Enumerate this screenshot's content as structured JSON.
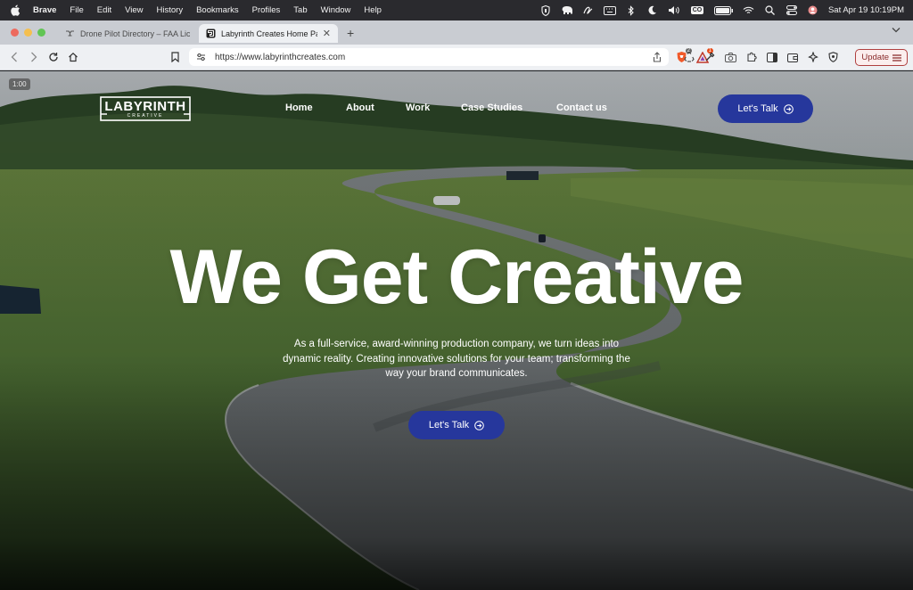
{
  "menubar": {
    "app": "Brave",
    "items": [
      "File",
      "Edit",
      "View",
      "History",
      "Bookmarks",
      "Profiles",
      "Tab",
      "Window",
      "Help"
    ],
    "tray_badge": "CO",
    "clock": "Sat Apr 19  10:19PM"
  },
  "tabs": [
    {
      "title": "Drone Pilot Directory – FAA Licen",
      "active": false
    },
    {
      "title": "Labyrinth Creates Home Page",
      "active": true
    }
  ],
  "toolbar": {
    "url": "https://www.labyrinthcreates.com",
    "shield_badge": "2",
    "alert_badge": "1",
    "update_label": "Update"
  },
  "video": {
    "time": "1:00"
  },
  "site": {
    "logo_word": "LABYRINTH",
    "logo_sub": "CREATIVE",
    "nav": [
      "Home",
      "About",
      "Work",
      "Case Studies",
      "Contact us"
    ],
    "cta_top": "Let's Talk",
    "headline": "We Get Creative",
    "subtext": "As a full-service, award-winning production company, we turn ideas into dynamic reality. Creating innovative solutions for your team; transforming the way your brand communicates.",
    "cta_main": "Let's Talk"
  },
  "colors": {
    "cta": "#26379c",
    "update_border": "#b04040"
  }
}
